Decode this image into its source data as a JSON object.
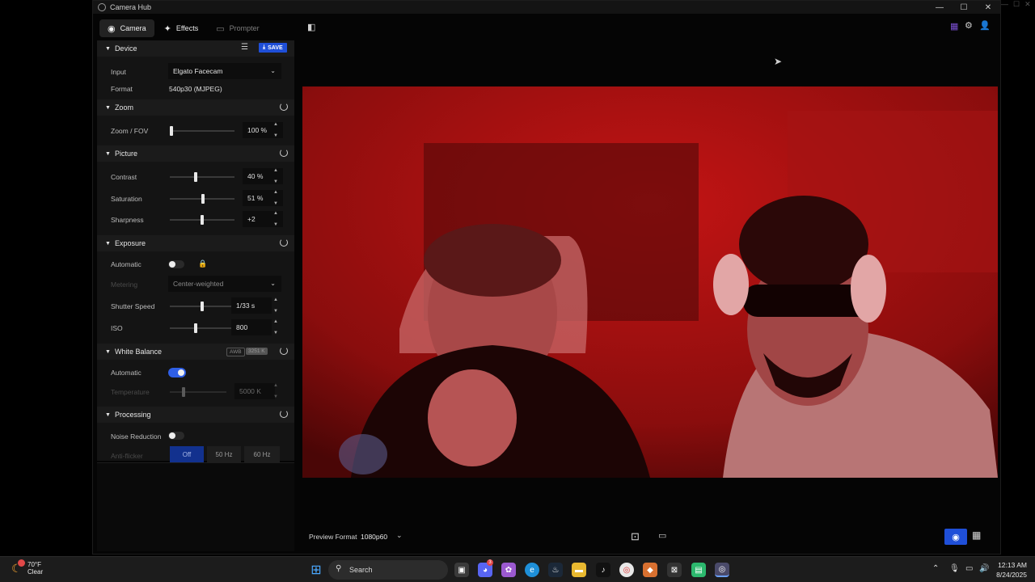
{
  "window": {
    "title": "Camera Hub",
    "controls": [
      "—",
      "☐",
      "✕"
    ]
  },
  "tabs": [
    {
      "label": "Camera",
      "icon": "camera-icon"
    },
    {
      "label": "Effects",
      "icon": "magic-wand-icon"
    },
    {
      "label": "Prompter",
      "icon": "prompter-icon"
    }
  ],
  "device": {
    "header": "Device",
    "save_label": "SAVE",
    "input_label": "Input",
    "input_value": "Elgato Facecam",
    "format_label": "Format",
    "format_value": "540p30 (MJPEG)"
  },
  "zoom": {
    "header": "Zoom",
    "label": "Zoom / FOV",
    "value": "100 %",
    "level": 0.0
  },
  "picture": {
    "header": "Picture",
    "contrast": {
      "label": "Contrast",
      "value": "40 %",
      "level": 0.4
    },
    "saturation": {
      "label": "Saturation",
      "value": "51 %",
      "level": 0.51
    },
    "sharpness": {
      "label": "Sharpness",
      "value": "+2",
      "level": 0.5
    }
  },
  "exposure": {
    "header": "Exposure",
    "automatic_label": "Automatic",
    "metering_label": "Metering",
    "metering_value": "Center-weighted",
    "shutter": {
      "label": "Shutter Speed",
      "value": "1/33 s",
      "level": 0.5
    },
    "iso": {
      "label": "ISO",
      "value": "800",
      "level": 0.4
    }
  },
  "white_balance": {
    "header": "White Balance",
    "badge_awb": "AWB",
    "badge_k": "3251 K",
    "automatic_label": "Automatic",
    "temperature": {
      "label": "Temperature",
      "value": "5000 K",
      "level": 0.22
    }
  },
  "processing": {
    "header": "Processing",
    "noise_label": "Noise Reduction",
    "antiflicker_label": "Anti-flicker",
    "antiflicker_options": [
      "Off",
      "50 Hz",
      "60 Hz"
    ]
  },
  "preview": {
    "format_label": "Preview Format",
    "format_value": "1080p60"
  },
  "taskbar": {
    "weather_temp": "70°F",
    "weather_desc": "Clear",
    "search_placeholder": "Search",
    "time": "12:13 AM",
    "date": "8/24/2025",
    "discord_badge": "3"
  },
  "colors": {
    "accent": "#1f4fd8",
    "scene": "#b50f0f"
  }
}
